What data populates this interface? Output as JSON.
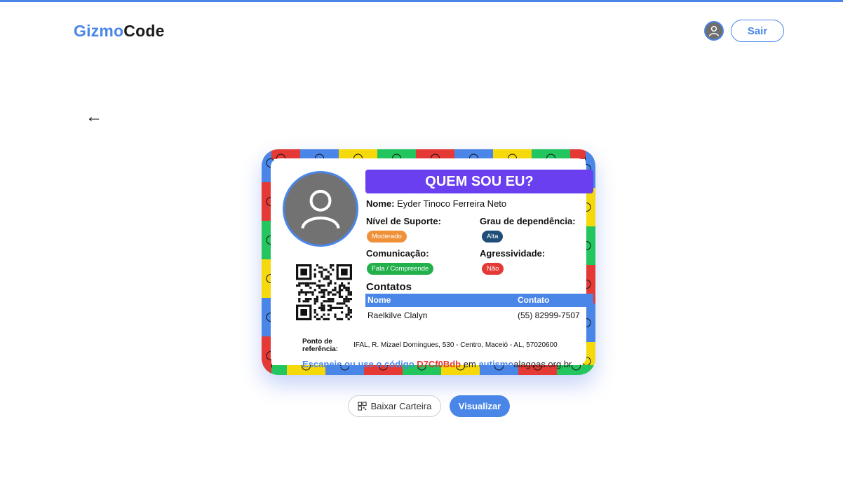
{
  "header": {
    "brand_part1": "Gizmo",
    "brand_part2": "Code",
    "logout_label": "Sair",
    "accent_color": "#4a86e8"
  },
  "nav": {
    "back_glyph": "←"
  },
  "card": {
    "title": "QUEM SOU EU?",
    "name_label": "Nome:",
    "name_value": "Eyder Tinoco Ferreira Neto",
    "support_label": "Nível de Suporte:",
    "support_value": "Moderado",
    "dependency_label": "Grau de dependência:",
    "dependency_value": "Alta",
    "communication_label": "Comunicação:",
    "communication_value": "Fala / Compreende",
    "aggressiveness_label": "Agressividade:",
    "aggressiveness_value": "Não",
    "contacts_title": "Contatos",
    "contacts_headers": [
      "Nome",
      "Contato"
    ],
    "contacts_rows": [
      {
        "name": "Raelkilve Clalyn",
        "contact": "(55) 82999-7507"
      }
    ],
    "reference_label_line1": "Ponto de",
    "reference_label_line2": "referência:",
    "reference_value": "IFAL, R. Mizael Domingues, 530 - Centro, Maceió - AL, 57020600",
    "scan_text_prefix": "Escaneie ou use o código",
    "scan_code": "D7Cf0Bdb",
    "scan_text_mid": "em",
    "site_part1": "autismo",
    "site_part2": "alagoas.org.br",
    "colors": {
      "banner": "#6a3ff0",
      "support_pill": "#f0913a",
      "dependency_pill": "#1f4e79",
      "communication_pill": "#22b04b",
      "aggressiveness_pill": "#e53935",
      "code_color": "#e53935"
    }
  },
  "actions": {
    "download_label": "Baixar Carteira",
    "view_label": "Visualizar"
  }
}
